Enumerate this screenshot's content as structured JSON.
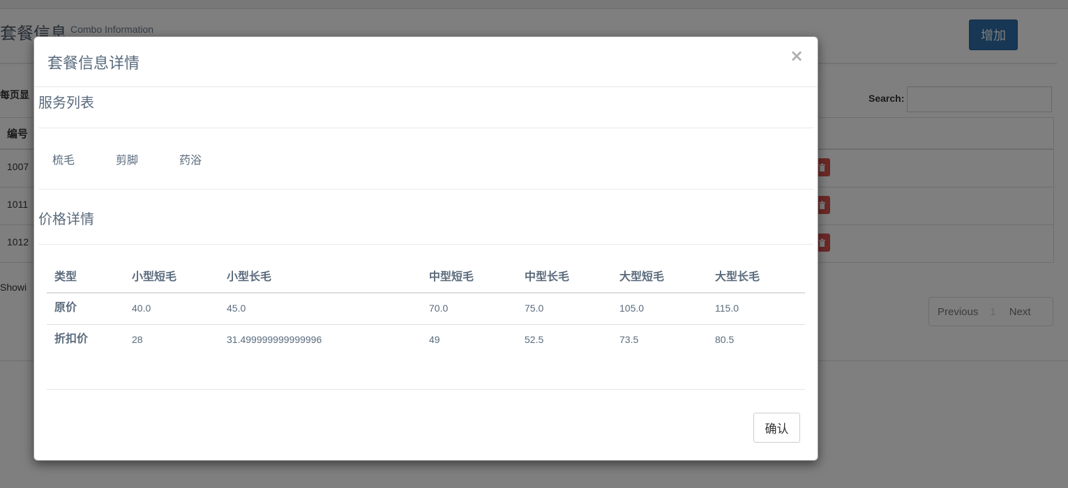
{
  "background": {
    "page_title": "套餐信息",
    "page_subtitle": "Combo Information",
    "add_button": "增加",
    "per_page_label": "每页显",
    "search_label": "Search:",
    "table_header_id": "编号",
    "rows": [
      "1007",
      "1011",
      "1012"
    ],
    "delete_icon": "trash-icon",
    "showing_text": "Showi",
    "pagination": {
      "previous": "Previous",
      "current": "1",
      "next": "Next"
    }
  },
  "modal": {
    "title": "套餐信息详情",
    "close_symbol": "×",
    "service_section_title": "服务列表",
    "services": [
      "梳毛",
      "剪脚",
      "药浴"
    ],
    "price_section_title": "价格详情",
    "price_table": {
      "headers": [
        "类型",
        "小型短毛",
        "小型长毛",
        "中型短毛",
        "中型长毛",
        "大型短毛",
        "大型长毛"
      ],
      "rows": [
        [
          "原价",
          "40.0",
          "45.0",
          "70.0",
          "75.0",
          "105.0",
          "115.0"
        ],
        [
          "折扣价",
          "28",
          "31.499999999999996",
          "49",
          "52.5",
          "73.5",
          "80.5"
        ]
      ]
    },
    "confirm_button": "确认"
  },
  "colors": {
    "primary_button": "#2f6ea9",
    "danger_button": "#d9534f",
    "modal_text": "#596a7c",
    "overlay": "rgba(0,0,0,0.5)"
  }
}
